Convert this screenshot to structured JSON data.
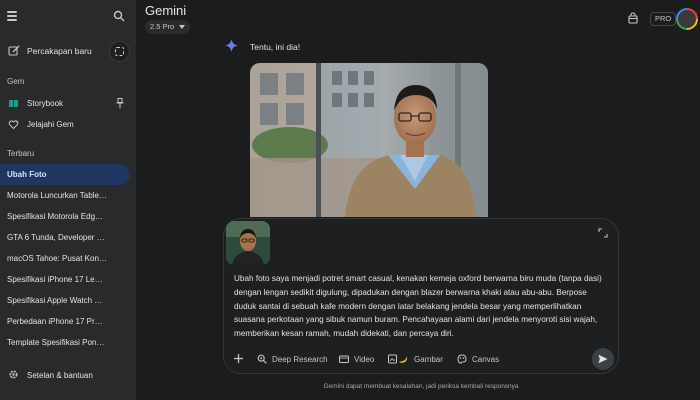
{
  "header": {
    "app_title": "Gemini",
    "model": "2.5 Pro",
    "plan_badge": "PRO"
  },
  "sidebar": {
    "new_chat_label": "Percakapan baru",
    "gems_title": "Gem",
    "gems": [
      {
        "label": "Storybook",
        "icon": "storybook-icon",
        "pinned": true
      },
      {
        "label": "Jelajahi Gem",
        "icon": "gem-explore-icon",
        "pinned": false
      }
    ],
    "recent_title": "Terbaru",
    "recent": [
      {
        "label": "Ubah Foto",
        "active": true
      },
      {
        "label": "Motorola Luncurkan Tablet ..."
      },
      {
        "label": "Spesifikasi Motorola Edge 6..."
      },
      {
        "label": "GTA 6 Tunda, Developer Lai..."
      },
      {
        "label": "macOS Tahoe: Pusat Kontr..."
      },
      {
        "label": "Spesifikasi iPhone 17 Lengk..."
      },
      {
        "label": "Spesifikasi Apple Watch Ser..."
      },
      {
        "label": "Perbedaan iPhone 17 Pro da..."
      },
      {
        "label": "Template Spesifikasi Ponsel..."
      }
    ],
    "settings_label": "Setelan & bantuan"
  },
  "chat": {
    "reply_text": "Tentu, ini dia!",
    "prompt_text": "Ubah foto saya menjadi potret smart casual, kenakan kemeja oxford berwarna biru muda (tanpa dasi) dengan lengan sedikit digulung, dipadukan dengan blazer berwarna khaki atau abu-abu. Berpose duduk santai di sebuah kafe modern dengan latar belakang jendela besar yang memperlihatkan suasana perkotaan yang sibuk namun buram. Pencahayaan alami dari jendela menyoroti sisi wajah, memberikan kesan ramah, mudah didekati, dan percaya diri."
  },
  "tools": [
    {
      "label": "Deep Research",
      "icon": "deep-research-icon"
    },
    {
      "label": "Video",
      "icon": "video-icon"
    },
    {
      "label": "Gambar",
      "icon": "image-banana-icon"
    },
    {
      "label": "Canvas",
      "icon": "canvas-icon"
    }
  ],
  "disclaimer": "Gemini dapat membuat kesalahan, jadi periksa kembali responsnya",
  "colors": {
    "background": "#1b1c1d",
    "sidebar": "#282a2c",
    "active_item": "#1f3760",
    "accent": "#4285f4"
  }
}
